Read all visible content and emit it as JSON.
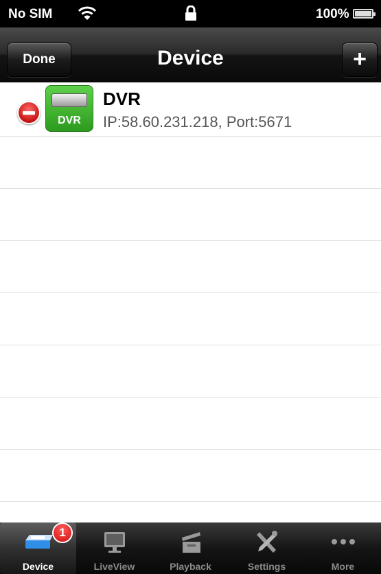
{
  "status_bar": {
    "carrier": "No SIM",
    "battery_percent": "100%"
  },
  "nav_bar": {
    "title": "Device",
    "left_button": "Done",
    "right_button": "+"
  },
  "devices": [
    {
      "name": "DVR",
      "icon_label": "DVR",
      "detail": "IP:58.60.231.218, Port:5671"
    }
  ],
  "tab_bar": {
    "tabs": [
      {
        "label": "Device",
        "icon": "dvr-device-icon",
        "badge": "1",
        "selected": true
      },
      {
        "label": "LiveView",
        "icon": "monitor-icon"
      },
      {
        "label": "Playback",
        "icon": "clapperboard-icon"
      },
      {
        "label": "Settings",
        "icon": "tools-icon"
      },
      {
        "label": "More",
        "icon": "more-dots-icon"
      }
    ]
  },
  "colors": {
    "device_icon": "#3fb32c",
    "delete": "#d10f0f",
    "badge": "#d10f0f"
  }
}
